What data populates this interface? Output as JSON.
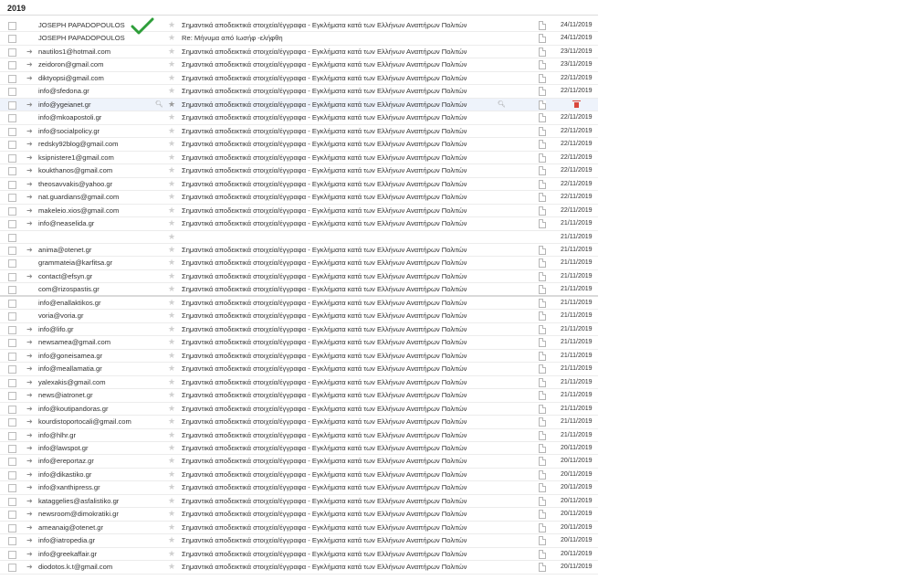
{
  "year_label": "2019",
  "subject_main": "Σημαντικά αποδεικτικά στοιχεία/έγγραφα - Εγκλήματα κατά των Ελλήνων Αναπήρων Πολιτών",
  "icons": {
    "forward": "forward-arrow-icon",
    "star": "star-icon",
    "attachment": "document-icon",
    "delete": "trash-icon",
    "search": "magnifier-icon",
    "checkmark": "green-checkmark-icon"
  },
  "colors": {
    "highlight_row": "#eef3fb",
    "trash": "#d9473b",
    "checkmark": "#2e9e3a"
  },
  "emails": [
    {
      "sender": "JOSEPH PAPADOPOULOS",
      "subject": "Σημαντικά αποδεικτικά στοιχεία/έγγραφα - Εγκλήματα κατά των Ελλήνων Αναπήρων Πολιτών",
      "date": "24/11/2019",
      "fwd": false
    },
    {
      "sender": "JOSEPH PAPADOPOULOS",
      "subject": "Re: Μήνυμα από Ιωσήφ -ελήφθη",
      "date": "24/11/2019",
      "fwd": false
    },
    {
      "sender": "nautilos1@hotmail.com",
      "subject": "Σημαντικά αποδεικτικά στοιχεία/έγγραφα - Εγκλήματα κατά των Ελλήνων Αναπήρων Πολιτών",
      "date": "23/11/2019",
      "fwd": true
    },
    {
      "sender": "zeidoron@gmail.com",
      "subject": "Σημαντικά αποδεικτικά στοιχεία/έγγραφα - Εγκλήματα κατά των Ελλήνων Αναπήρων Πολιτών",
      "date": "23/11/2019",
      "fwd": true
    },
    {
      "sender": "diktyopsi@gmail.com",
      "subject": "Σημαντικά αποδεικτικά στοιχεία/έγγραφα - Εγκλήματα κατά των Ελλήνων Αναπήρων Πολιτών",
      "date": "22/11/2019",
      "fwd": true
    },
    {
      "sender": "info@sfedona.gr",
      "subject": "Σημαντικά αποδεικτικά στοιχεία/έγγραφα - Εγκλήματα κατά των Ελλήνων Αναπήρων Πολιτών",
      "date": "22/11/2019",
      "fwd": false
    },
    {
      "sender": "info@ygeianet.gr",
      "subject": "Σημαντικά αποδεικτικά στοιχεία/έγγραφα - Εγκλήματα κατά των Ελλήνων Αναπήρων Πολιτών",
      "date": "",
      "fwd": true,
      "highlight": true
    },
    {
      "sender": "info@mkoapostoli.gr",
      "subject": "Σημαντικά αποδεικτικά στοιχεία/έγγραφα - Εγκλήματα κατά των Ελλήνων Αναπήρων Πολιτών",
      "date": "22/11/2019",
      "fwd": false
    },
    {
      "sender": "info@socialpolicy.gr",
      "subject": "Σημαντικά αποδεικτικά στοιχεία/έγγραφα - Εγκλήματα κατά των Ελλήνων Αναπήρων Πολιτών",
      "date": "22/11/2019",
      "fwd": true
    },
    {
      "sender": "redsky92blog@gmail.com",
      "subject": "Σημαντικά αποδεικτικά στοιχεία/έγγραφα - Εγκλήματα κατά των Ελλήνων Αναπήρων Πολιτών",
      "date": "22/11/2019",
      "fwd": true
    },
    {
      "sender": "ksipnistere1@gmail.com",
      "subject": "Σημαντικά αποδεικτικά στοιχεία/έγγραφα - Εγκλήματα κατά των Ελλήνων Αναπήρων Πολιτών",
      "date": "22/11/2019",
      "fwd": true
    },
    {
      "sender": "koukthanos@gmail.com",
      "subject": "Σημαντικά αποδεικτικά στοιχεία/έγγραφα - Εγκλήματα κατά των Ελλήνων Αναπήρων Πολιτών",
      "date": "22/11/2019",
      "fwd": true
    },
    {
      "sender": "theosavvakis@yahoo.gr",
      "subject": "Σημαντικά αποδεικτικά στοιχεία/έγγραφα - Εγκλήματα κατά των Ελλήνων Αναπήρων Πολιτών",
      "date": "22/11/2019",
      "fwd": true
    },
    {
      "sender": "nat.guardians@gmail.com",
      "subject": "Σημαντικά αποδεικτικά στοιχεία/έγγραφα - Εγκλήματα κατά των Ελλήνων Αναπήρων Πολιτών",
      "date": "22/11/2019",
      "fwd": true
    },
    {
      "sender": "makeleio.xios@gmail.com",
      "subject": "Σημαντικά αποδεικτικά στοιχεία/έγγραφα - Εγκλήματα κατά των Ελλήνων Αναπήρων Πολιτών",
      "date": "22/11/2019",
      "fwd": true
    },
    {
      "sender": "info@neaselida.gr",
      "subject": "Σημαντικά αποδεικτικά στοιχεία/έγγραφα - Εγκλήματα κατά των Ελλήνων Αναπήρων Πολιτών",
      "date": "21/11/2019",
      "fwd": true
    },
    {
      "sender": "",
      "subject": "",
      "date": "21/11/2019",
      "fwd": false
    },
    {
      "sender": "anima@otenet.gr",
      "subject": "Σημαντικά αποδεικτικά στοιχεία/έγγραφα - Εγκλήματα κατά των Ελλήνων Αναπήρων Πολιτών",
      "date": "21/11/2019",
      "fwd": true
    },
    {
      "sender": "grammateia@karfitsa.gr",
      "subject": "Σημαντικά αποδεικτικά στοιχεία/έγγραφα - Εγκλήματα κατά των Ελλήνων Αναπήρων Πολιτών",
      "date": "21/11/2019",
      "fwd": false
    },
    {
      "sender": "contact@efsyn.gr",
      "subject": "Σημαντικά αποδεικτικά στοιχεία/έγγραφα - Εγκλήματα κατά των Ελλήνων Αναπήρων Πολιτών",
      "date": "21/11/2019",
      "fwd": true
    },
    {
      "sender": "com@rizospastis.gr",
      "subject": "Σημαντικά αποδεικτικά στοιχεία/έγγραφα - Εγκλήματα κατά των Ελλήνων Αναπήρων Πολιτών",
      "date": "21/11/2019",
      "fwd": false,
      "gap": true
    },
    {
      "sender": "info@enallaktikos.gr",
      "subject": "Σημαντικά αποδεικτικά στοιχεία/έγγραφα - Εγκλήματα κατά των Ελλήνων Αναπήρων Πολιτών",
      "date": "21/11/2019",
      "fwd": false
    },
    {
      "sender": "voria@voria.gr",
      "subject": "Σημαντικά αποδεικτικά στοιχεία/έγγραφα - Εγκλήματα κατά των Ελλήνων Αναπήρων Πολιτών",
      "date": "21/11/2019",
      "fwd": false
    },
    {
      "sender": "info@lifo.gr",
      "subject": "Σημαντικά αποδεικτικά στοιχεία/έγγραφα - Εγκλήματα κατά των Ελλήνων Αναπήρων Πολιτών",
      "date": "21/11/2019",
      "fwd": true
    },
    {
      "sender": "newsamea@gmail.com",
      "subject": "Σημαντικά αποδεικτικά στοιχεία/έγγραφα - Εγκλήματα κατά των Ελλήνων Αναπήρων Πολιτών",
      "date": "21/11/2019",
      "fwd": true
    },
    {
      "sender": "info@goneisamea.gr",
      "subject": "Σημαντικά αποδεικτικά στοιχεία/έγγραφα - Εγκλήματα κατά των Ελλήνων Αναπήρων Πολιτών",
      "date": "21/11/2019",
      "fwd": true
    },
    {
      "sender": "info@meallamatia.gr",
      "subject": "Σημαντικά αποδεικτικά στοιχεία/έγγραφα - Εγκλήματα κατά των Ελλήνων Αναπήρων Πολιτών",
      "date": "21/11/2019",
      "fwd": true
    },
    {
      "sender": "yalexakis@gmail.com",
      "subject": "Σημαντικά αποδεικτικά στοιχεία/έγγραφα - Εγκλήματα κατά των Ελλήνων Αναπήρων Πολιτών",
      "date": "21/11/2019",
      "fwd": true
    },
    {
      "sender": "news@iatronet.gr",
      "subject": "Σημαντικά αποδεικτικά στοιχεία/έγγραφα - Εγκλήματα κατά των Ελλήνων Αναπήρων Πολιτών",
      "date": "21/11/2019",
      "fwd": true
    },
    {
      "sender": "info@koutipandoras.gr",
      "subject": "Σημαντικά αποδεικτικά στοιχεία/έγγραφα - Εγκλήματα κατά των Ελλήνων Αναπήρων Πολιτών",
      "date": "21/11/2019",
      "fwd": true
    },
    {
      "sender": "kourdistoportocali@gmail.com",
      "subject": "Σημαντικά αποδεικτικά στοιχεία/έγγραφα - Εγκλήματα κατά των Ελλήνων Αναπήρων Πολιτών",
      "date": "21/11/2019",
      "fwd": true
    },
    {
      "sender": "info@hlhr.gr",
      "subject": "Σημαντικά αποδεικτικά στοιχεία/έγγραφα - Εγκλήματα κατά των Ελλήνων Αναπήρων Πολιτών",
      "date": "21/11/2019",
      "fwd": true
    },
    {
      "sender": "info@lawspot.gr",
      "subject": "Σημαντικά αποδεικτικά στοιχεία/έγγραφα - Εγκλήματα κατά των Ελλήνων Αναπήρων Πολιτών",
      "date": "20/11/2019",
      "fwd": true
    },
    {
      "sender": "info@ereportaz.gr",
      "subject": "Σημαντικά αποδεικτικά στοιχεία/έγγραφα - Εγκλήματα κατά των Ελλήνων Αναπήρων Πολιτών",
      "date": "20/11/2019",
      "fwd": true
    },
    {
      "sender": "info@dikastiko.gr",
      "subject": "Σημαντικά αποδεικτικά στοιχεία/έγγραφα - Εγκλήματα κατά των Ελλήνων Αναπήρων Πολιτών",
      "date": "20/11/2019",
      "fwd": true
    },
    {
      "sender": "info@xanthipress.gr",
      "subject": "Σημαντικά αποδεικτικά στοιχεία/έγγραφα - Εγκλήματα κατά των Ελλήνων Αναπήρων Πολιτών",
      "date": "20/11/2019",
      "fwd": true
    },
    {
      "sender": "kataggelies@asfalistiko.gr",
      "subject": "Σημαντικά αποδεικτικά στοιχεία/έγγραφα - Εγκλήματα κατά των Ελλήνων Αναπήρων Πολιτών",
      "date": "20/11/2019",
      "fwd": true
    },
    {
      "sender": "newsroom@dimokratiki.gr",
      "subject": "Σημαντικά αποδεικτικά στοιχεία/έγγραφα - Εγκλήματα κατά των Ελλήνων Αναπήρων Πολιτών",
      "date": "20/11/2019",
      "fwd": true
    },
    {
      "sender": "ameanaig@otenet.gr",
      "subject": "Σημαντικά αποδεικτικά στοιχεία/έγγραφα - Εγκλήματα κατά των Ελλήνων Αναπήρων Πολιτών",
      "date": "20/11/2019",
      "fwd": true
    },
    {
      "sender": "info@iatropedia.gr",
      "subject": "Σημαντικά αποδεικτικά στοιχεία/έγγραφα - Εγκλήματα κατά των Ελλήνων Αναπήρων Πολιτών",
      "date": "20/11/2019",
      "fwd": true
    },
    {
      "sender": "info@greekaffair.gr",
      "subject": "Σημαντικά αποδεικτικά στοιχεία/έγγραφα - Εγκλήματα κατά των Ελλήνων Αναπήρων Πολιτών",
      "date": "20/11/2019",
      "fwd": true
    },
    {
      "sender": "diodotos.k.t@gmail.com",
      "subject": "Σημαντικά αποδεικτικά στοιχεία/έγγραφα - Εγκλήματα κατά των Ελλήνων Αναπήρων Πολιτών",
      "date": "20/11/2019",
      "fwd": true
    }
  ]
}
